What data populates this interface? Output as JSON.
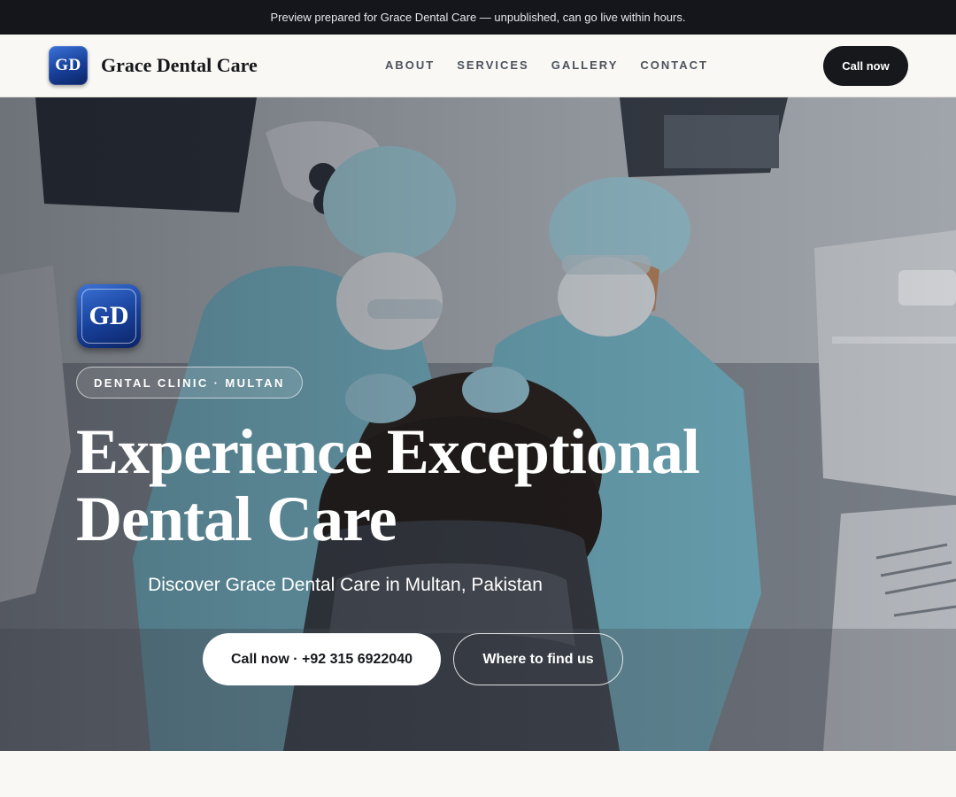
{
  "banner": {
    "text": "Preview prepared for Grace Dental Care — unpublished, can go live within hours."
  },
  "header": {
    "logo_initials": "GD",
    "brand_name": "Grace Dental Care",
    "nav": [
      {
        "label": "ABOUT"
      },
      {
        "label": "SERVICES"
      },
      {
        "label": "GALLERY"
      },
      {
        "label": "CONTACT"
      }
    ],
    "cta_label": "Call now"
  },
  "hero": {
    "background_image": "dentists-treating-patient-photo",
    "logo_initials": "GD",
    "tag": "DENTAL CLINIC · MULTAN",
    "headline_line1": "Experience Exceptional",
    "headline_line2": "Dental Care",
    "subheadline": "Discover Grace Dental Care in Multan, Pakistan",
    "primary_button": "Call now · +92 315 6922040",
    "secondary_button": "Where to find us"
  },
  "colors": {
    "banner_bg": "#14161b",
    "page_bg": "#f9f8f5",
    "dark_button": "#17181c",
    "logo_blue": "#173f98",
    "scrubs": "#7fc4d4"
  }
}
